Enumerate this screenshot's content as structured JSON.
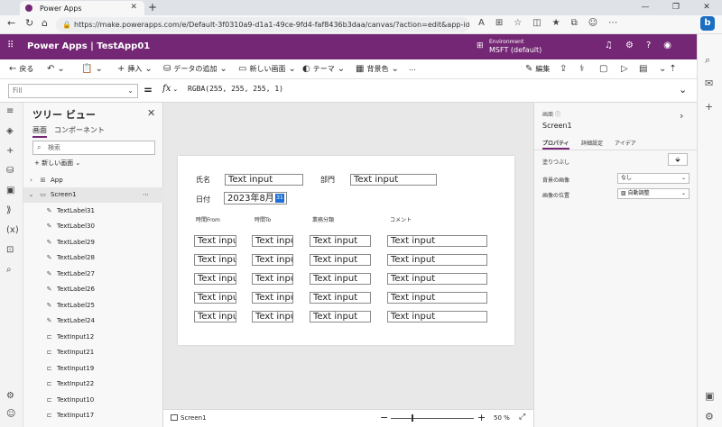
{
  "browser": {
    "tab_title": "Power Apps",
    "url": "https://make.powerapps.com/e/Default-3f0310a9-d1a1-49ce-9fd4-faf8436b3daa/canvas/?action=edit&app-id=/providers/Micros...",
    "reader_label": "A",
    "bing_label": "b"
  },
  "header": {
    "app_title": "Power Apps  |  TestApp01",
    "env_caption": "Environment",
    "env_name": "MSFT (default)"
  },
  "commands": {
    "back": "戻る",
    "insert": "挿入",
    "add_data": "データの追加",
    "new_screen": "新しい画面",
    "theme": "テーマ",
    "background": "背景色",
    "more": "...",
    "share": "編集"
  },
  "formula_bar": {
    "property": "Fill",
    "equals": "=",
    "fx": "fx",
    "formula": "RGBA(255, 255, 255, 1)"
  },
  "tree": {
    "title": "ツリー ビュー",
    "tab_screens": "画面",
    "tab_components": "コンポーネント",
    "search_placeholder": "検索",
    "new_screen": "新しい画面",
    "items": [
      {
        "label": "App",
        "icon": "app-icon"
      },
      {
        "label": "Screen1",
        "icon": "screen-icon"
      },
      {
        "label": "TextLabel31",
        "icon": "label-icon"
      },
      {
        "label": "TextLabel30",
        "icon": "label-icon"
      },
      {
        "label": "TextLabel29",
        "icon": "label-icon"
      },
      {
        "label": "TextLabel28",
        "icon": "label-icon"
      },
      {
        "label": "TextLabel27",
        "icon": "label-icon"
      },
      {
        "label": "TextLabel26",
        "icon": "label-icon"
      },
      {
        "label": "TextLabel25",
        "icon": "label-icon"
      },
      {
        "label": "TextLabel24",
        "icon": "label-icon"
      },
      {
        "label": "TextInput12",
        "icon": "input-icon"
      },
      {
        "label": "TextInput21",
        "icon": "input-icon"
      },
      {
        "label": "TextInput19",
        "icon": "input-icon"
      },
      {
        "label": "TextInput22",
        "icon": "input-icon"
      },
      {
        "label": "TextInput10",
        "icon": "input-icon"
      },
      {
        "label": "TextInput17",
        "icon": "input-icon"
      }
    ]
  },
  "canvas": {
    "label_name": "氏名",
    "label_dept": "部門",
    "label_date": "日付",
    "input_name": "Text input",
    "input_dept": "Text input",
    "date_value": "2023年8月",
    "col_from": "時間From",
    "col_to": "時間To",
    "col_category": "業務分類",
    "col_comment": "コメント",
    "grid_input": "Text input"
  },
  "statusbar": {
    "screen": "Screen1",
    "zoom": "50  %"
  },
  "right_panel": {
    "caption": "画面",
    "name": "Screen1",
    "tab_properties": "プロパティ",
    "tab_advanced": "詳細設定",
    "tab_ideas": "アイデア",
    "fill_label": "塗りつぶし",
    "bg_image_label": "背景の画像",
    "bg_image_value": "なし",
    "image_pos_label": "画像の位置",
    "image_pos_value": "自動調整"
  }
}
